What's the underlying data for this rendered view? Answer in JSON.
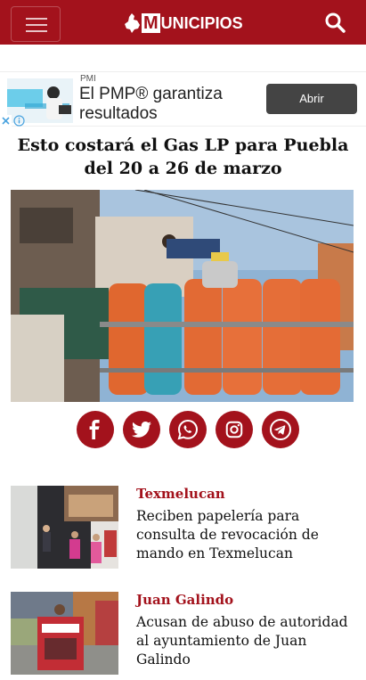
{
  "header": {
    "logo_letter": "M",
    "logo_text": "UNICIPIOS",
    "brand_color": "#a3121c"
  },
  "ad": {
    "sponsor": "PMI",
    "headline": "El PMP® garantiza resultados",
    "cta": "Abrir"
  },
  "article": {
    "title": "Esto costará el Gas LP para Puebla del 20 a 26 de marzo"
  },
  "share": {
    "networks": [
      "facebook",
      "twitter",
      "whatsapp",
      "instagram",
      "telegram"
    ]
  },
  "related": [
    {
      "category": "Texmelucan",
      "title": "Reciben papelería para consulta de revocación de mando en Texmelucan"
    },
    {
      "category": "Juan Galindo",
      "title": "Acusan de abuso de autoridad al ayuntamiento de Juan Galindo"
    }
  ]
}
